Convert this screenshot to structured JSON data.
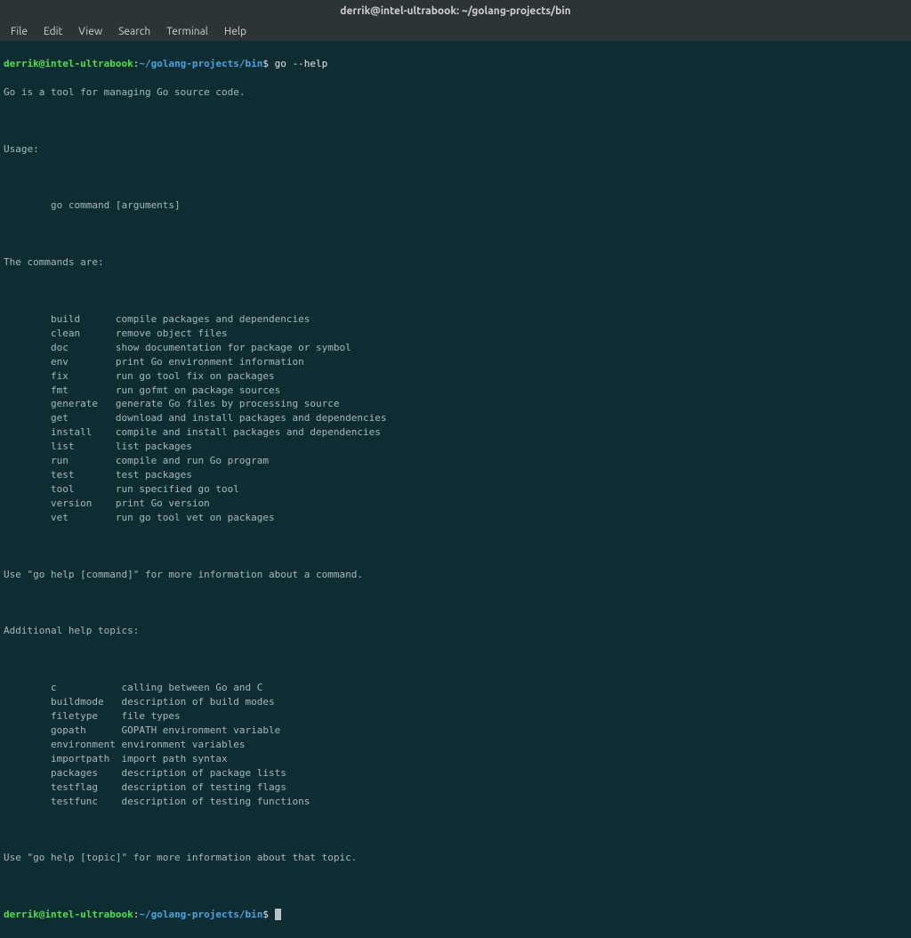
{
  "titlebar": "derrik@intel-ultrabook: ~/golang-projects/bin",
  "menu": {
    "file": "File",
    "edit": "Edit",
    "view": "View",
    "search": "Search",
    "terminal": "Terminal",
    "help": "Help"
  },
  "prompt": {
    "user": "derrik@intel-ultrabook",
    "colon": ":",
    "path": "~/golang-projects/bin",
    "dollar": "$"
  },
  "command": "go --help",
  "output": {
    "intro": "Go is a tool for managing Go source code.",
    "usage_label": "Usage:",
    "usage_line": "        go command [arguments]",
    "commands_label": "The commands are:",
    "commands": [
      {
        "name": "build",
        "desc": "compile packages and dependencies"
      },
      {
        "name": "clean",
        "desc": "remove object files"
      },
      {
        "name": "doc",
        "desc": "show documentation for package or symbol"
      },
      {
        "name": "env",
        "desc": "print Go environment information"
      },
      {
        "name": "fix",
        "desc": "run go tool fix on packages"
      },
      {
        "name": "fmt",
        "desc": "run gofmt on package sources"
      },
      {
        "name": "generate",
        "desc": "generate Go files by processing source"
      },
      {
        "name": "get",
        "desc": "download and install packages and dependencies"
      },
      {
        "name": "install",
        "desc": "compile and install packages and dependencies"
      },
      {
        "name": "list",
        "desc": "list packages"
      },
      {
        "name": "run",
        "desc": "compile and run Go program"
      },
      {
        "name": "test",
        "desc": "test packages"
      },
      {
        "name": "tool",
        "desc": "run specified go tool"
      },
      {
        "name": "version",
        "desc": "print Go version"
      },
      {
        "name": "vet",
        "desc": "run go tool vet on packages"
      }
    ],
    "help_cmd": "Use \"go help [command]\" for more information about a command.",
    "topics_label": "Additional help topics:",
    "topics": [
      {
        "name": "c",
        "desc": "calling between Go and C"
      },
      {
        "name": "buildmode",
        "desc": "description of build modes"
      },
      {
        "name": "filetype",
        "desc": "file types"
      },
      {
        "name": "gopath",
        "desc": "GOPATH environment variable"
      },
      {
        "name": "environment",
        "desc": "environment variables"
      },
      {
        "name": "importpath",
        "desc": "import path syntax"
      },
      {
        "name": "packages",
        "desc": "description of package lists"
      },
      {
        "name": "testflag",
        "desc": "description of testing flags"
      },
      {
        "name": "testfunc",
        "desc": "description of testing functions"
      }
    ],
    "help_topic": "Use \"go help [topic]\" for more information about that topic."
  }
}
